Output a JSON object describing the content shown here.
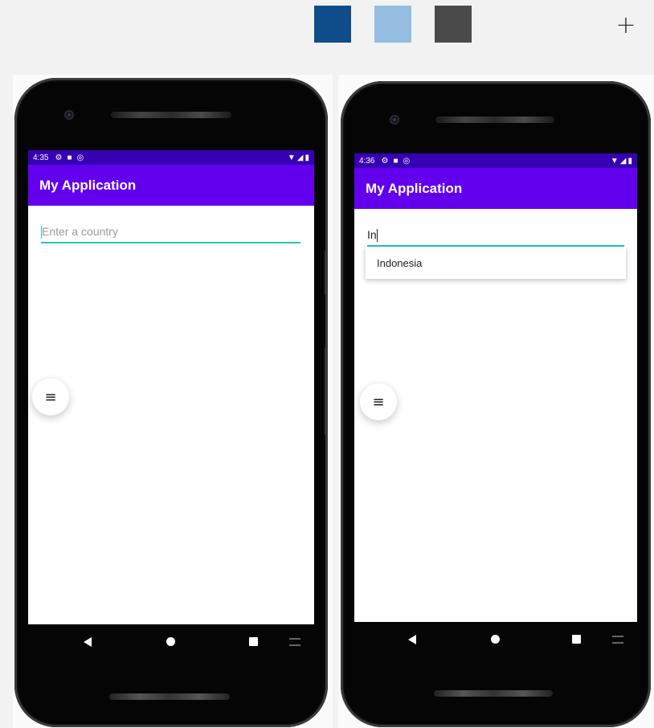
{
  "toolbar": {
    "swatches": [
      "#0f4c8a",
      "#94bde0",
      "#4a4a4a"
    ],
    "add_label": "+"
  },
  "phones": [
    {
      "status_time": "4:35",
      "app_title": "My Application",
      "input_value": "",
      "input_placeholder": "Enter a country"
    },
    {
      "status_time": "4:36",
      "app_title": "My Application",
      "input_value": "In",
      "input_placeholder": "",
      "suggestion": "Indonesia"
    }
  ],
  "colors": {
    "status_bar": "#3700b3",
    "app_bar": "#6200ee",
    "input_underline": "#26c6b0"
  },
  "icons": {
    "status": [
      "gear-icon",
      "sim-card-icon",
      "sync-icon"
    ],
    "signal": [
      "wifi-icon",
      "cell-signal-icon",
      "battery-icon"
    ],
    "fab": "menu-icon",
    "nav": [
      "back-icon",
      "home-icon",
      "recents-icon",
      "keyboard-icon"
    ]
  }
}
